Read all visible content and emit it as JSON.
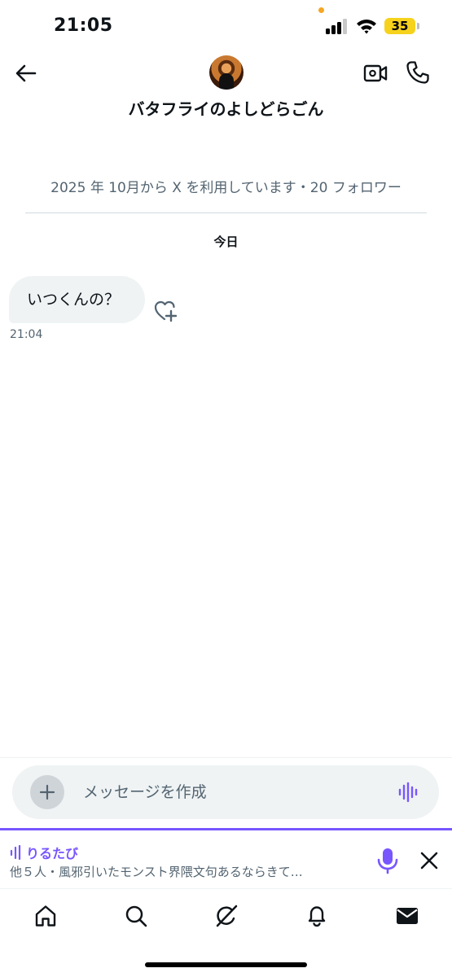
{
  "status_bar": {
    "time": "21:05",
    "battery": "35",
    "icons": [
      "signal-icon",
      "wifi-icon",
      "battery-icon"
    ],
    "battery_color": "#f6d21c"
  },
  "header": {
    "display_name": "バタフライのよしどらごん",
    "icons": [
      "back-arrow-icon",
      "avatar",
      "video-call-icon",
      "phone-icon"
    ]
  },
  "conversation": {
    "join_info": "2025 年 10月から X を利用しています・20 フォロワー",
    "date_separator": "今日",
    "messages": [
      {
        "text": "いつくんの？",
        "time": "21:04",
        "direction": "incoming"
      }
    ]
  },
  "composer": {
    "placeholder": "メッセージを作成",
    "value": "",
    "icons": [
      "plus-icon",
      "voice-wave-icon"
    ]
  },
  "space_bar": {
    "title": "りるたび",
    "subtitle": "他５人・風邪引いたモンスト界隈文句あるならきて…",
    "accent_color": "#7856ff",
    "icons": [
      "audio-wave-icon",
      "microphone-icon",
      "close-icon"
    ]
  },
  "tab_bar": {
    "tabs": [
      "home-icon",
      "search-icon",
      "grok-icon",
      "notifications-icon",
      "messages-icon"
    ],
    "active": "messages-icon"
  }
}
